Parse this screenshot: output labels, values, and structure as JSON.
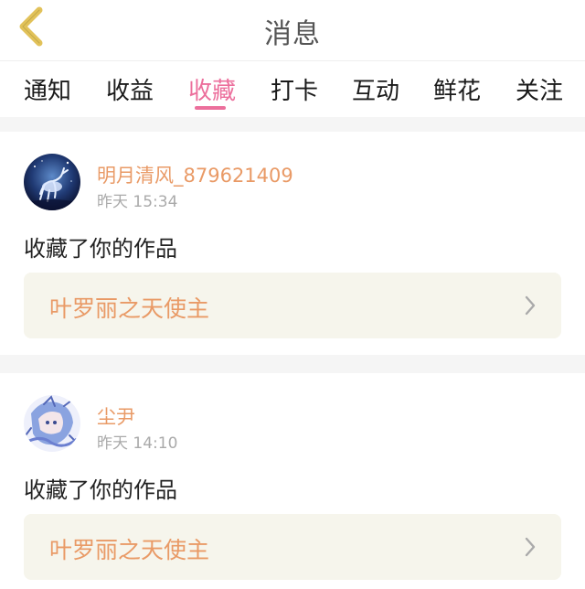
{
  "header": {
    "title": "消息"
  },
  "tabs": [
    {
      "label": "通知",
      "active": false
    },
    {
      "label": "收益",
      "active": false
    },
    {
      "label": "收藏",
      "active": true
    },
    {
      "label": "打卡",
      "active": false
    },
    {
      "label": "互动",
      "active": false
    },
    {
      "label": "鲜花",
      "active": false
    },
    {
      "label": "关注",
      "active": false
    }
  ],
  "messages": [
    {
      "username": "明月清风_879621409",
      "time": "昨天 15:34",
      "action": "收藏了你的作品",
      "work_title": "叶罗丽之天使主"
    },
    {
      "username": "尘尹",
      "time": "昨天 14:10",
      "action": "收藏了你的作品",
      "work_title": "叶罗丽之天使主"
    }
  ],
  "colors": {
    "accent_pink": "#ec6f9c",
    "username_orange": "#e99a66",
    "back_arrow": "#e2c25a",
    "card_box": "#f6f5ec"
  },
  "icons": {
    "back": "chevron-left-icon",
    "row_arrow": "chevron-right-icon"
  }
}
